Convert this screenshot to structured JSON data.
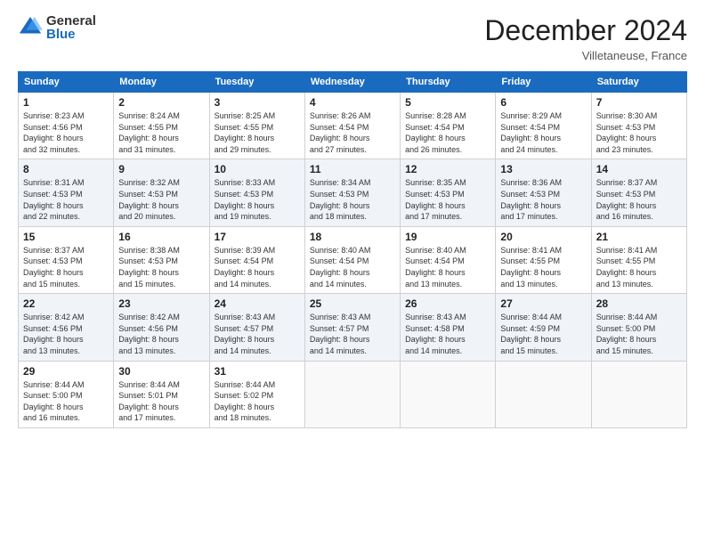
{
  "logo": {
    "general": "General",
    "blue": "Blue"
  },
  "header": {
    "title": "December 2024",
    "location": "Villetaneuse, France"
  },
  "weekdays": [
    "Sunday",
    "Monday",
    "Tuesday",
    "Wednesday",
    "Thursday",
    "Friday",
    "Saturday"
  ],
  "weeks": [
    [
      {
        "day": "1",
        "info": "Sunrise: 8:23 AM\nSunset: 4:56 PM\nDaylight: 8 hours\nand 32 minutes."
      },
      {
        "day": "2",
        "info": "Sunrise: 8:24 AM\nSunset: 4:55 PM\nDaylight: 8 hours\nand 31 minutes."
      },
      {
        "day": "3",
        "info": "Sunrise: 8:25 AM\nSunset: 4:55 PM\nDaylight: 8 hours\nand 29 minutes."
      },
      {
        "day": "4",
        "info": "Sunrise: 8:26 AM\nSunset: 4:54 PM\nDaylight: 8 hours\nand 27 minutes."
      },
      {
        "day": "5",
        "info": "Sunrise: 8:28 AM\nSunset: 4:54 PM\nDaylight: 8 hours\nand 26 minutes."
      },
      {
        "day": "6",
        "info": "Sunrise: 8:29 AM\nSunset: 4:54 PM\nDaylight: 8 hours\nand 24 minutes."
      },
      {
        "day": "7",
        "info": "Sunrise: 8:30 AM\nSunset: 4:53 PM\nDaylight: 8 hours\nand 23 minutes."
      }
    ],
    [
      {
        "day": "8",
        "info": "Sunrise: 8:31 AM\nSunset: 4:53 PM\nDaylight: 8 hours\nand 22 minutes."
      },
      {
        "day": "9",
        "info": "Sunrise: 8:32 AM\nSunset: 4:53 PM\nDaylight: 8 hours\nand 20 minutes."
      },
      {
        "day": "10",
        "info": "Sunrise: 8:33 AM\nSunset: 4:53 PM\nDaylight: 8 hours\nand 19 minutes."
      },
      {
        "day": "11",
        "info": "Sunrise: 8:34 AM\nSunset: 4:53 PM\nDaylight: 8 hours\nand 18 minutes."
      },
      {
        "day": "12",
        "info": "Sunrise: 8:35 AM\nSunset: 4:53 PM\nDaylight: 8 hours\nand 17 minutes."
      },
      {
        "day": "13",
        "info": "Sunrise: 8:36 AM\nSunset: 4:53 PM\nDaylight: 8 hours\nand 17 minutes."
      },
      {
        "day": "14",
        "info": "Sunrise: 8:37 AM\nSunset: 4:53 PM\nDaylight: 8 hours\nand 16 minutes."
      }
    ],
    [
      {
        "day": "15",
        "info": "Sunrise: 8:37 AM\nSunset: 4:53 PM\nDaylight: 8 hours\nand 15 minutes."
      },
      {
        "day": "16",
        "info": "Sunrise: 8:38 AM\nSunset: 4:53 PM\nDaylight: 8 hours\nand 15 minutes."
      },
      {
        "day": "17",
        "info": "Sunrise: 8:39 AM\nSunset: 4:54 PM\nDaylight: 8 hours\nand 14 minutes."
      },
      {
        "day": "18",
        "info": "Sunrise: 8:40 AM\nSunset: 4:54 PM\nDaylight: 8 hours\nand 14 minutes."
      },
      {
        "day": "19",
        "info": "Sunrise: 8:40 AM\nSunset: 4:54 PM\nDaylight: 8 hours\nand 13 minutes."
      },
      {
        "day": "20",
        "info": "Sunrise: 8:41 AM\nSunset: 4:55 PM\nDaylight: 8 hours\nand 13 minutes."
      },
      {
        "day": "21",
        "info": "Sunrise: 8:41 AM\nSunset: 4:55 PM\nDaylight: 8 hours\nand 13 minutes."
      }
    ],
    [
      {
        "day": "22",
        "info": "Sunrise: 8:42 AM\nSunset: 4:56 PM\nDaylight: 8 hours\nand 13 minutes."
      },
      {
        "day": "23",
        "info": "Sunrise: 8:42 AM\nSunset: 4:56 PM\nDaylight: 8 hours\nand 13 minutes."
      },
      {
        "day": "24",
        "info": "Sunrise: 8:43 AM\nSunset: 4:57 PM\nDaylight: 8 hours\nand 14 minutes."
      },
      {
        "day": "25",
        "info": "Sunrise: 8:43 AM\nSunset: 4:57 PM\nDaylight: 8 hours\nand 14 minutes."
      },
      {
        "day": "26",
        "info": "Sunrise: 8:43 AM\nSunset: 4:58 PM\nDaylight: 8 hours\nand 14 minutes."
      },
      {
        "day": "27",
        "info": "Sunrise: 8:44 AM\nSunset: 4:59 PM\nDaylight: 8 hours\nand 15 minutes."
      },
      {
        "day": "28",
        "info": "Sunrise: 8:44 AM\nSunset: 5:00 PM\nDaylight: 8 hours\nand 15 minutes."
      }
    ],
    [
      {
        "day": "29",
        "info": "Sunrise: 8:44 AM\nSunset: 5:00 PM\nDaylight: 8 hours\nand 16 minutes."
      },
      {
        "day": "30",
        "info": "Sunrise: 8:44 AM\nSunset: 5:01 PM\nDaylight: 8 hours\nand 17 minutes."
      },
      {
        "day": "31",
        "info": "Sunrise: 8:44 AM\nSunset: 5:02 PM\nDaylight: 8 hours\nand 18 minutes."
      },
      null,
      null,
      null,
      null
    ]
  ]
}
